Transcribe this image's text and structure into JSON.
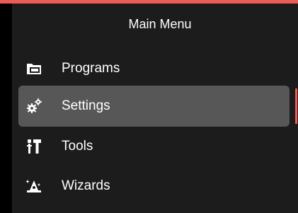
{
  "menu": {
    "title": "Main Menu",
    "items": [
      {
        "label": "Programs",
        "icon": "folder-icon",
        "selected": false
      },
      {
        "label": "Settings",
        "icon": "gears-icon",
        "selected": true
      },
      {
        "label": "Tools",
        "icon": "tools-icon",
        "selected": false
      },
      {
        "label": "Wizards",
        "icon": "wizard-hat-icon",
        "selected": false
      }
    ]
  },
  "colors": {
    "accent": "#ec5b55",
    "panel": "#1c1c1c",
    "selected_bg": "#575757",
    "text": "#ffffff"
  }
}
